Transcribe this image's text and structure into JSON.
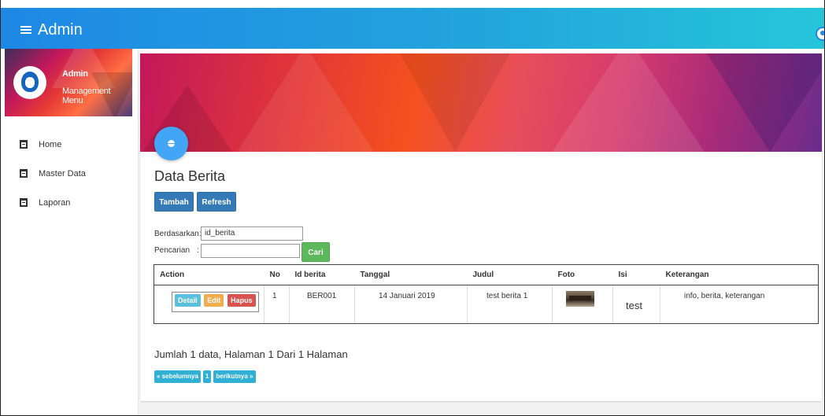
{
  "header": {
    "title": "Admin",
    "menu_icon": "hamburger-icon",
    "user_icon": "user-avatar-icon"
  },
  "sidebar": {
    "profile": {
      "name": "Admin",
      "subtitle": "Management Menu"
    },
    "items": [
      {
        "label": "Home",
        "icon": "clipboard-icon"
      },
      {
        "label": "Master Data",
        "icon": "clipboard-icon"
      },
      {
        "label": "Laporan",
        "icon": "clipboard-icon"
      }
    ]
  },
  "main": {
    "title": "Data Berita",
    "buttons": {
      "add": "Tambah",
      "refresh": "Refresh"
    },
    "filter": {
      "by_label": "Berdasarkan:",
      "by_value": "id_berita",
      "search_label": "Pencarian",
      "search_colon": ":",
      "search_value": "",
      "search_button": "Cari"
    },
    "table": {
      "headers": [
        "Action",
        "No",
        "Id berita",
        "Tanggal",
        "Judul",
        "Foto",
        "Isi",
        "Keterangan"
      ],
      "rows": [
        {
          "actions": [
            "Detail",
            "Edit",
            "Hapus"
          ],
          "no": "1",
          "id": "BER001",
          "tanggal": "14 Januari 2019",
          "judul": "test berita 1",
          "isi": "test",
          "keterangan": "info, berita, keterangan"
        }
      ]
    },
    "summary": "Jumlah 1 data, Halaman 1 Dari 1 Halaman",
    "pager": {
      "prev": "« sebelumnya",
      "page": "1",
      "next": "berikutnya »"
    }
  },
  "colors": {
    "topbar": "#1e88e5",
    "primary": "#337ab7",
    "success": "#5cb85c",
    "info": "#5bc0de",
    "warning": "#f0ad4e",
    "danger": "#d9534f"
  }
}
